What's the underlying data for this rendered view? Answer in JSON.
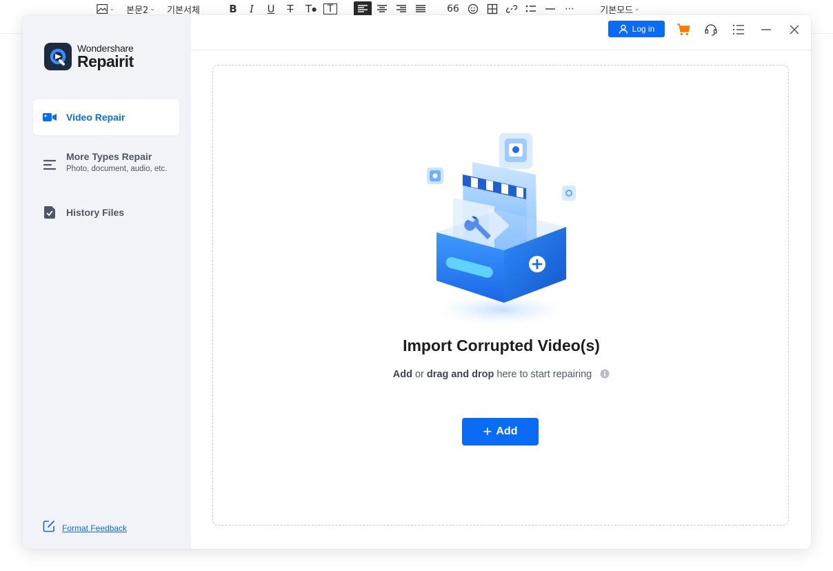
{
  "editor_toolbar": {
    "style_label": "본문2",
    "font_label": "기본서체",
    "bold": "B",
    "italic": "I",
    "underline": "U",
    "strike": "T",
    "text_color": "T",
    "text_box": "T",
    "quote": "66",
    "mode_label": "기본모드"
  },
  "app": {
    "brand": "Wondershare",
    "product": "Repairit"
  },
  "sidebar": {
    "items": [
      {
        "label": "Video Repair",
        "sub": "",
        "icon": "video-camera-icon",
        "active": true
      },
      {
        "label": "More Types Repair",
        "sub": "Photo, document, audio, etc.",
        "icon": "list-icon",
        "active": false
      },
      {
        "label": "History Files",
        "sub": "",
        "icon": "file-check-icon",
        "active": false
      }
    ],
    "feedback_label": "Format Feedback"
  },
  "titlebar": {
    "login_label": "Log in"
  },
  "main": {
    "title": "Import Corrupted Video(s)",
    "subtitle_add": "Add",
    "subtitle_or": " or ",
    "subtitle_drag": "drag and drop",
    "subtitle_rest": " here to start repairing",
    "add_button_label": "Add"
  },
  "colors": {
    "accent": "#0a6cf5",
    "sidebar_bg": "#f1f3f9",
    "cart": "#ff7a00"
  }
}
